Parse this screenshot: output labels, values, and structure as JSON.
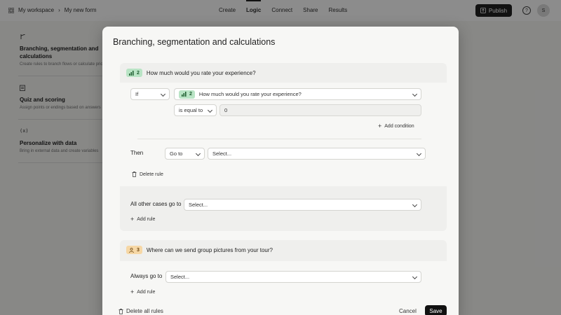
{
  "topbar": {
    "workspace": "My workspace",
    "separator": "›",
    "form_name": "My new form",
    "nav": [
      "Create",
      "Logic",
      "Connect",
      "Share",
      "Results"
    ],
    "active_nav": "Logic",
    "publish_label": "Publish",
    "avatar_initial": "S"
  },
  "logic_panel": {
    "items": [
      {
        "title": "Branching, segmentation and calculations",
        "desc": "Create rules to branch flows or calculate prices"
      },
      {
        "title": "Quiz and scoring",
        "desc": "Assign points or endings based on answers"
      },
      {
        "title": "Personalize with data",
        "desc": "Bring in external data and create variables"
      }
    ]
  },
  "modal": {
    "title": "Branching, segmentation and calculations",
    "q1": {
      "number": "2",
      "text": "How much would you rate your experience?",
      "if_label": "If",
      "condition_question_number": "2",
      "condition_question": "How much would you rate your experience?",
      "operator": "is equal to",
      "value": "0",
      "add_condition": "Add condition",
      "then_label": "Then",
      "action": "Go to",
      "target_placeholder": "Select...",
      "delete_rule": "Delete rule",
      "other_cases_label": "All other cases go to",
      "other_cases_placeholder": "Select...",
      "add_rule": "Add rule"
    },
    "q2": {
      "number": "3",
      "text": "Where can we send group pictures from your tour?",
      "always_label": "Always go to",
      "always_placeholder": "Select...",
      "add_rule": "Add rule"
    },
    "footer": {
      "delete_all": "Delete all rules",
      "cancel": "Cancel",
      "save": "Save"
    }
  },
  "colors": {
    "badge_green": "#b9e4c5",
    "badge_orange": "#f6d7a5",
    "primary_button": "#111111"
  }
}
